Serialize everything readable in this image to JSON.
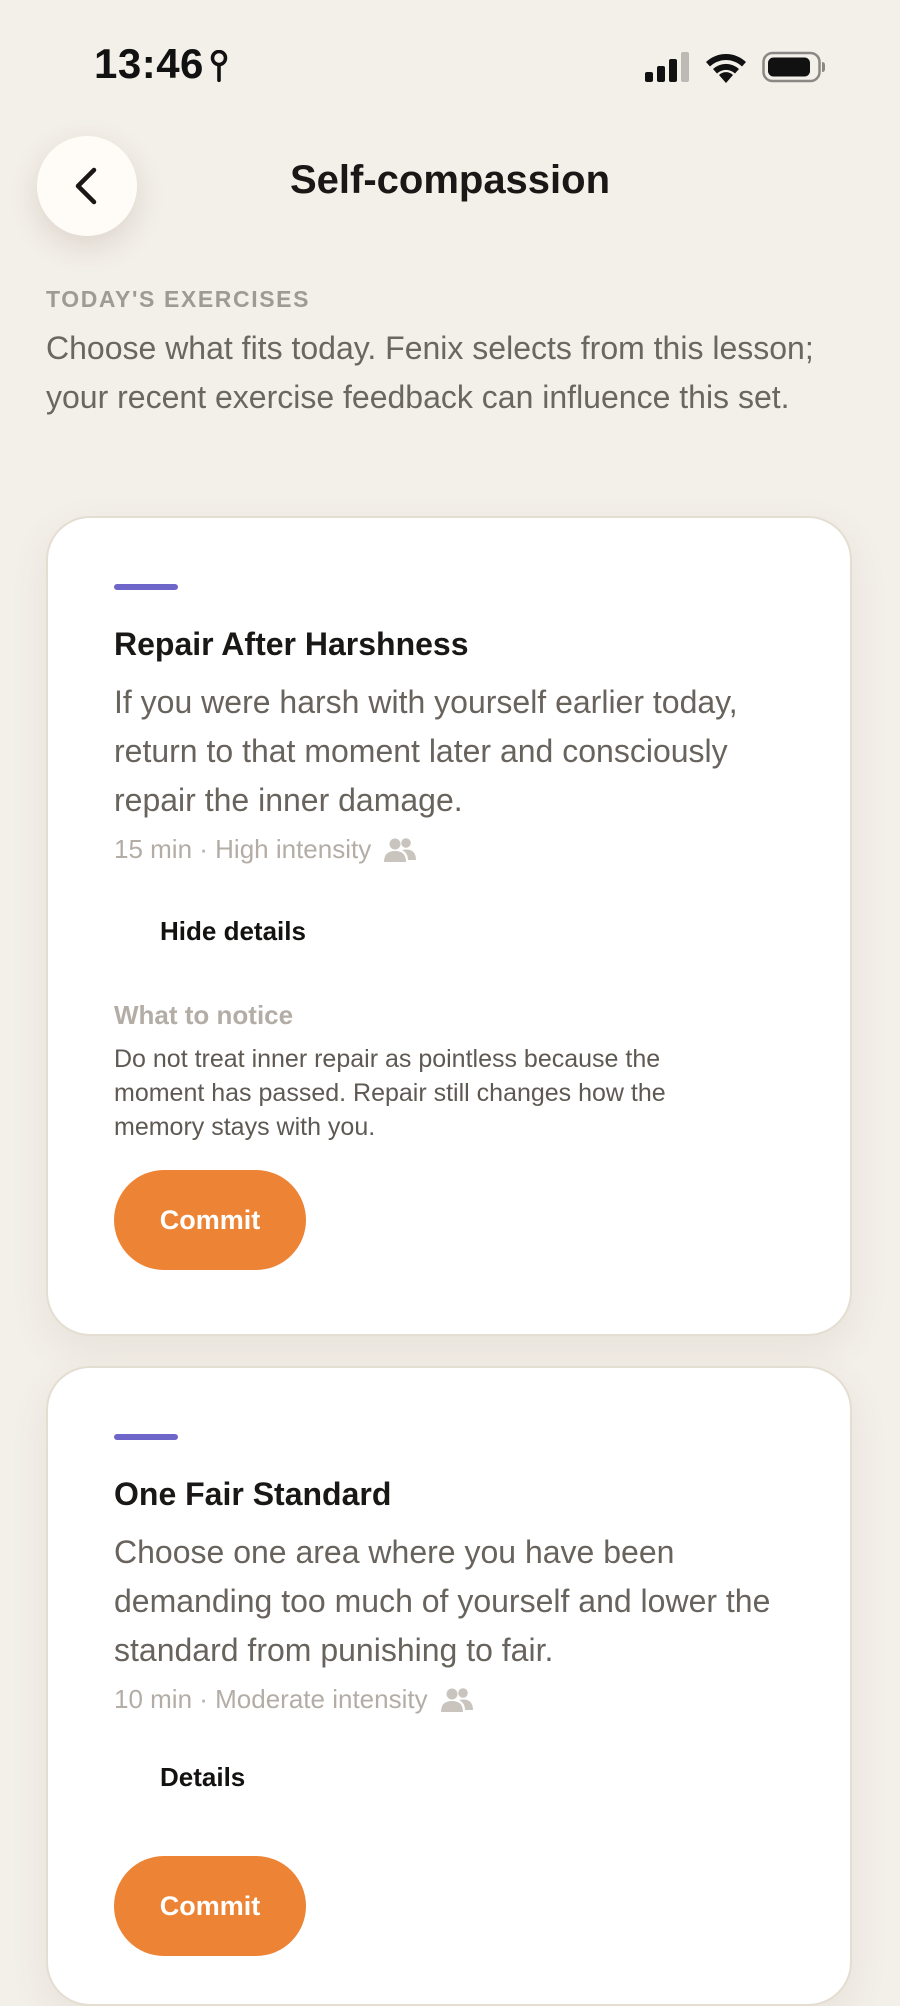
{
  "status_bar": {
    "time": "13:46",
    "location_icon": "location-pin-icon",
    "signal_icon": "cellular-signal-icon",
    "wifi_icon": "wifi-icon",
    "battery_icon": "battery-icon"
  },
  "header": {
    "back_icon": "chevron-left-icon",
    "title": "Self-compassion"
  },
  "intro": {
    "label": "TODAY'S EXERCISES",
    "description": "Choose what fits today. Fenix selects from this lesson; your recent exercise feedback can influence this set."
  },
  "colors": {
    "background": "#f3efe9",
    "card": "#ffffff",
    "accent": "#6e66c9",
    "commit": "#ed8435",
    "muted": "#b3ada6"
  },
  "exercises": [
    {
      "title": "Repair After Harshness",
      "description": "If you were harsh with yourself earlier today, return to that moment later and consciously repair the inner damage.",
      "meta": "15 min · High intensity",
      "meta_icon": "people-icon",
      "details_toggle": "Hide details",
      "notice_label": "What to notice",
      "notice_text": "Do not treat inner repair as pointless because the moment has passed. Repair still changes how the memory stays with you.",
      "commit_label": "Commit"
    },
    {
      "title": "One Fair Standard",
      "description": "Choose one area where you have been demanding too much of yourself and lower the standard from punishing to fair.",
      "meta": "10 min · Moderate intensity",
      "meta_icon": "people-icon",
      "details_toggle": "Details",
      "commit_label": "Commit"
    }
  ]
}
